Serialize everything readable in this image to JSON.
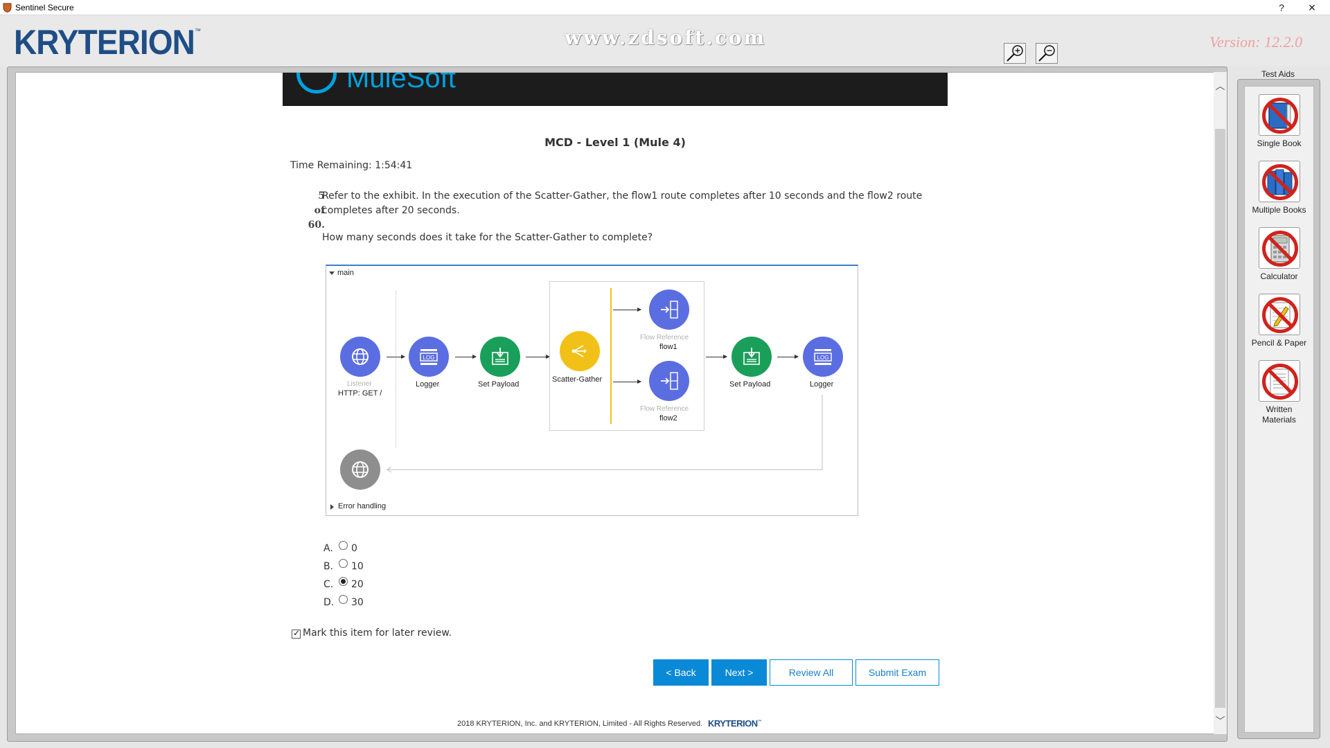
{
  "window": {
    "title": "Sentinel Secure",
    "help_label": "?",
    "close_label": "✕"
  },
  "header": {
    "logo_text": "KRYTERION",
    "logo_tm": "™",
    "watermark": "www.zdsoft.com",
    "version": "Version:  12.2.0",
    "zoom_in_icon": "zoom-in-icon",
    "zoom_out_icon": "zoom-out-icon"
  },
  "banner": {
    "brand_text": "MuleSoft"
  },
  "exam": {
    "title": "MCD - Level 1 (Mule 4)",
    "time_remaining": "Time Remaining: 1:54:41",
    "question_number": "5",
    "question_of": "of",
    "question_total": "60.",
    "question_text": "Refer to the exhibit. In the execution of the Scatter-Gather, the flow1 route completes after 10 seconds and the flow2 route completes after 20 seconds.",
    "question_ask": "How many seconds does it take for the Scatter-Gather to complete?"
  },
  "exhibit": {
    "flow_name": "main",
    "error_handling": "Error handling",
    "nodes": {
      "listener_sub": "Listener",
      "listener": "HTTP: GET /",
      "logger1": "Logger",
      "set_payload1": "Set Payload",
      "scatter_gather": "Scatter-Gather",
      "flowref1_sub": "Flow Reference",
      "flowref1": "flow1",
      "flowref2_sub": "Flow Reference",
      "flowref2": "flow2",
      "set_payload2": "Set Payload",
      "logger2": "Logger"
    },
    "colors": {
      "listener": "#5b6ee1",
      "logger": "#5b6ee1",
      "set_payload": "#1a9f5a",
      "scatter_gather": "#f2c117",
      "flow_ref": "#5b6ee1",
      "error_node": "#8e8e8e"
    }
  },
  "answers": [
    {
      "letter": "A.",
      "value": "0",
      "selected": false
    },
    {
      "letter": "B.",
      "value": "10",
      "selected": false
    },
    {
      "letter": "C.",
      "value": "20",
      "selected": true
    },
    {
      "letter": "D.",
      "value": "30",
      "selected": false
    }
  ],
  "review": {
    "label": "Mark this item for later review.",
    "checked": true
  },
  "buttons": {
    "back": "< Back",
    "next": "Next >",
    "review_all": "Review All",
    "submit": "Submit Exam"
  },
  "footer": {
    "copyright": "2018    KRYTERION, Inc. and KRYTERION, Limited - All Rights Reserved.",
    "logo": "KRYTERION"
  },
  "test_aids": {
    "title": "Test Aids",
    "items": [
      {
        "label": "Single Book"
      },
      {
        "label": "Multiple Books"
      },
      {
        "label": "Calculator"
      },
      {
        "label": "Pencil & Paper"
      },
      {
        "label": "Written\nMaterials"
      }
    ]
  }
}
